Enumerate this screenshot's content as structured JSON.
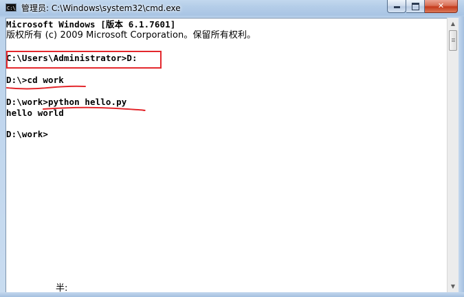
{
  "window": {
    "title": "管理员: C:\\Windows\\system32\\cmd.exe",
    "icon": "cmd-console-icon",
    "icon_text": "C:\\",
    "controls": {
      "minimize_icon": "minimize-icon",
      "maximize_icon": "maximize-icon",
      "close_label": "✕"
    }
  },
  "console": {
    "lines": [
      "Microsoft Windows [版本 6.1.7601]",
      "版权所有 (c) 2009 Microsoft Corporation。保留所有权利。",
      "C:\\Users\\Administrator>D:",
      "D:\\>cd work",
      "D:\\work>python hello.py",
      "hello world",
      "D:\\work>"
    ],
    "ime_indicator": "半:"
  },
  "annotations": {
    "highlight_color": "#e3262b"
  },
  "scrollbar": {
    "up_arrow": "▲",
    "down_arrow": "▼"
  }
}
